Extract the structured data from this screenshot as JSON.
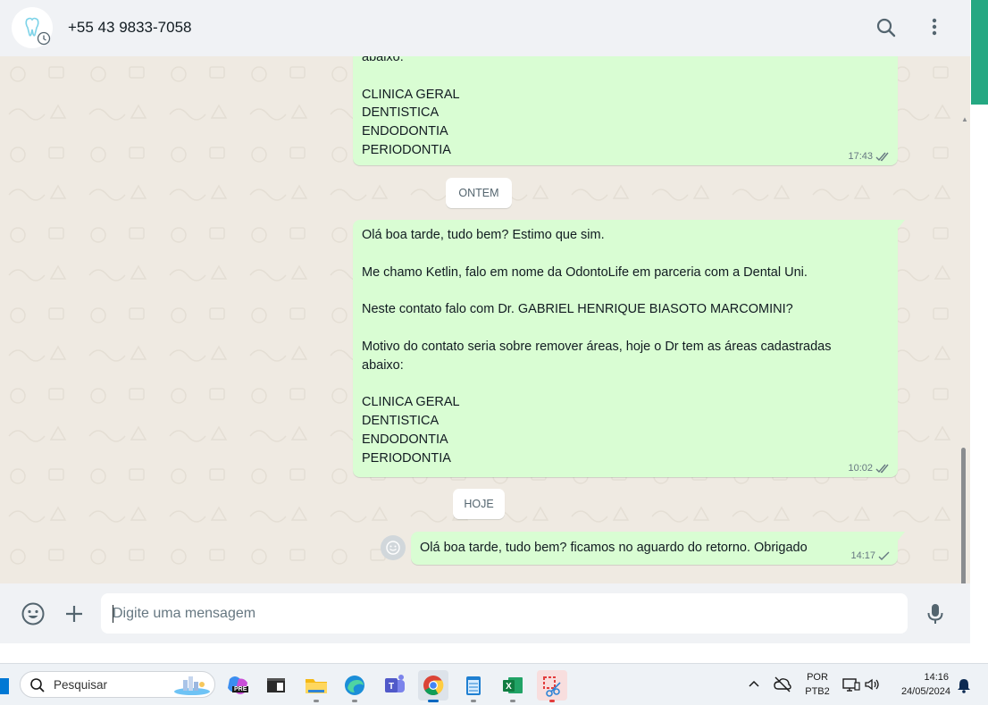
{
  "header": {
    "contact_name": "+55 43 9833-7058",
    "icons": [
      "avatar-tooth-logo",
      "search-icon",
      "menu-icon"
    ]
  },
  "messages": [
    {
      "id": "m1",
      "text": "abaixo:\n\nCLINICA GERAL\nDENTISTICA\nENDODONTIA\nPERIODONTIA",
      "time": "17:43",
      "status": "read"
    },
    {
      "id": "m2",
      "text": "Olá boa tarde, tudo bem? Estimo que sim.\n\nMe chamo Ketlin, falo em nome da OdontoLife em parceria com a Dental Uni.\n\nNeste contato falo com Dr. GABRIEL HENRIQUE BIASOTO MARCOMINI?\n\nMotivo do contato seria sobre remover áreas, hoje o Dr tem as áreas cadastradas\nabaixo:\n\nCLINICA GERAL\nDENTISTICA\nENDODONTIA\nPERIODONTIA",
      "time": "10:02",
      "status": "read"
    },
    {
      "id": "m3",
      "text": "Olá boa tarde, tudo bem? ficamos no aguardo do retorno. Obrigado",
      "time": "14:17",
      "status": "sent"
    }
  ],
  "date_dividers": {
    "yesterday": "ONTEM",
    "today": "HOJE"
  },
  "composer": {
    "placeholder": "Digite uma mensagem",
    "icons": [
      "emoji-icon",
      "plus-icon",
      "mic-icon"
    ]
  },
  "taskbar": {
    "search_placeholder": "Pesquisar",
    "copilot_badge": "PRE",
    "apps": [
      "copilot",
      "terminal",
      "file-explorer",
      "edge",
      "teams",
      "chrome",
      "notepad",
      "excel",
      "snipping-tool"
    ],
    "language_top": "POR",
    "language_bottom": "PTB2",
    "time": "14:16",
    "date": "24/05/2024"
  },
  "colors": {
    "header_bg": "#f0f2f5",
    "chat_bg": "#efeae2",
    "outgoing_bubble": "#d9fdd3",
    "read_tick": "#667781",
    "accent_green": "#25a882"
  }
}
